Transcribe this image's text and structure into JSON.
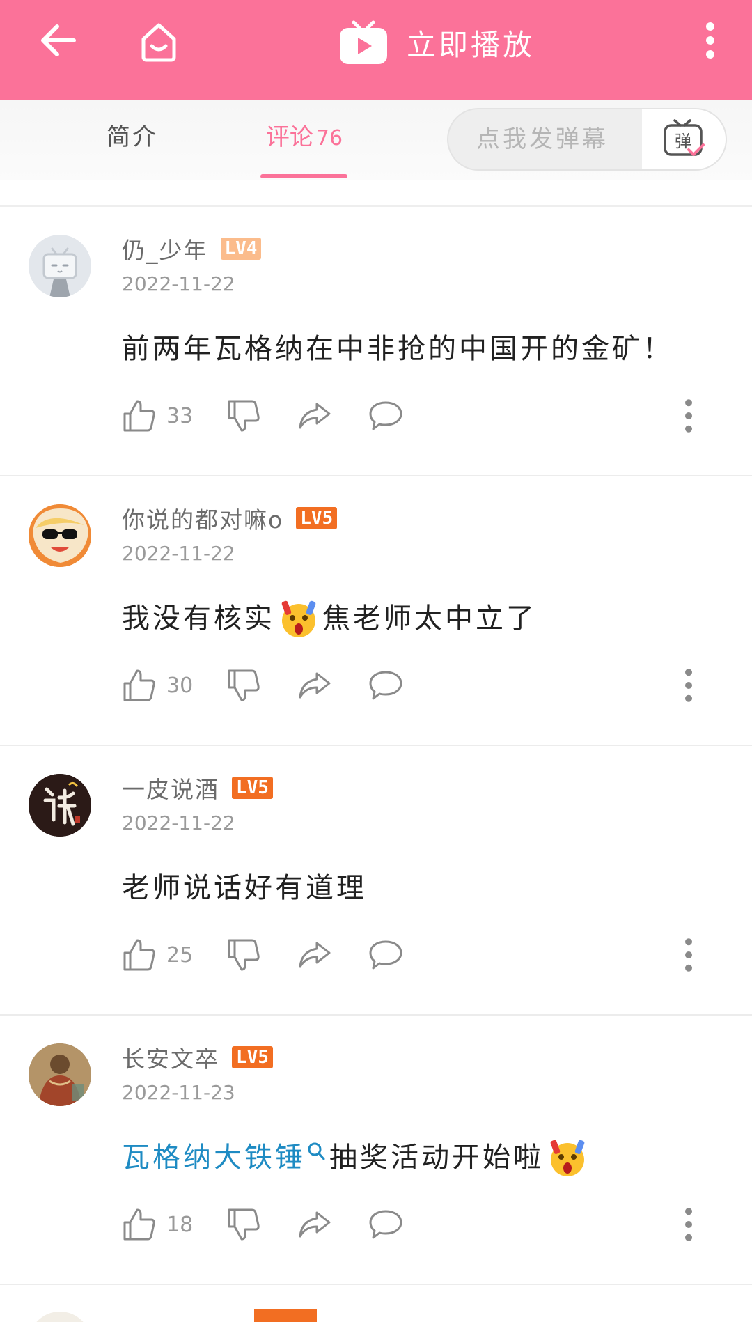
{
  "header": {
    "title": "立即播放",
    "back_icon": "arrow-left-icon",
    "home_icon": "home-icon",
    "more_icon": "more-vertical-icon",
    "background_color": "#fb7299"
  },
  "tabs": {
    "intro_label": "简介",
    "comments_label": "评论",
    "comments_count": "76",
    "active": "comments",
    "accent_color": "#fb7299"
  },
  "danmaku": {
    "placeholder": "点我发弹幕",
    "button_glyph": "弹"
  },
  "comments": [
    {
      "username": "仍_少年",
      "level": "LV4",
      "date": "2022-11-22",
      "text": "前两年瓦格纳在中非抢的中国开的金矿！",
      "likes": "33"
    },
    {
      "username": "你说的都对嘛o",
      "level": "LV5",
      "date": "2022-11-22",
      "text_before": "我没有核实",
      "text_after": "焦老师太中立了",
      "likes": "30"
    },
    {
      "username": "一皮说酒",
      "level": "LV5",
      "date": "2022-11-22",
      "text": "老师说话好有道理",
      "likes": "25"
    },
    {
      "username": "长安文卒",
      "level": "LV5",
      "date": "2022-11-23",
      "link_text": "瓦格纳大铁锤",
      "text_after": "抽奖活动开始啦",
      "likes": "18"
    }
  ]
}
